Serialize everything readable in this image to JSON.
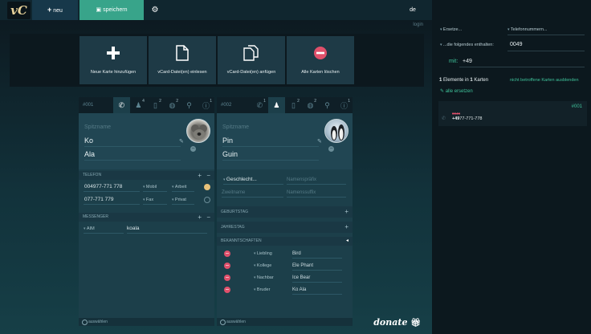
{
  "app": {
    "logo_text": "vC"
  },
  "toolbar": {
    "new_label": "neu",
    "save_label": "speichern",
    "lang": "de",
    "login": "login"
  },
  "actions": [
    {
      "label": "Neue Karte hinzufügen",
      "icon": "plus-icon"
    },
    {
      "label": "vCard-Datei(en) einlesen",
      "icon": "file-icon"
    },
    {
      "label": "vCard-Datei(en) anfügen",
      "icon": "files-icon"
    },
    {
      "label": "Alle Karten löschen",
      "icon": "delete-icon"
    }
  ],
  "card1": {
    "id": "#001",
    "tabs": [
      {
        "icon": "phone-icon",
        "badge": ""
      },
      {
        "icon": "people-icon",
        "badge": "4"
      },
      {
        "icon": "doc-icon",
        "badge": "2"
      },
      {
        "icon": "globe-icon",
        "badge": "2"
      },
      {
        "icon": "pin-icon",
        "badge": ""
      },
      {
        "icon": "info-icon",
        "badge": "1"
      }
    ],
    "nickname_placeholder": "Spitzname",
    "first_name": "Ko",
    "last_name": "Ala",
    "phone_section": "TELEFON",
    "phones": [
      {
        "number": "004977-771 778",
        "type": "Mobil",
        "category": "Arbeit",
        "preferred": true
      },
      {
        "number": "077-771 779",
        "type": "Fax",
        "category": "Privat",
        "preferred": false
      }
    ],
    "messenger_section": "MESSENGER",
    "messenger": {
      "service": "AIM",
      "handle": "koala"
    },
    "footer": "auswählen"
  },
  "card2": {
    "id": "#002",
    "tabs": [
      {
        "icon": "phone-icon",
        "badge": "1"
      },
      {
        "icon": "person-icon",
        "badge": ""
      },
      {
        "icon": "doc-icon",
        "badge": "2"
      },
      {
        "icon": "globe-icon",
        "badge": "2"
      },
      {
        "icon": "pin-icon",
        "badge": ""
      },
      {
        "icon": "info-icon",
        "badge": "1"
      }
    ],
    "nickname_placeholder": "Spitzname",
    "first_name": "Pin",
    "last_name": "Guin",
    "gender": "Geschlecht...",
    "name_prefix_placeholder": "Namenspräfix",
    "middle_name_placeholder": "Zweitname",
    "name_suffix_placeholder": "Namenssuffix",
    "birthday_section": "GEBURTSTAG",
    "anniversary_section": "JAHRESTAG",
    "relations_section": "BEKANNTSCHAFTEN",
    "relations": [
      {
        "type": "Liebling",
        "name": "Bird"
      },
      {
        "type": "Kollege",
        "name": "Ele Phant"
      },
      {
        "type": "Nachbar",
        "name": "Ice Bear"
      },
      {
        "type": "Bruder",
        "name": "Ko Ala"
      }
    ],
    "footer": "auswählen"
  },
  "replace": {
    "mode": "Ersetze...",
    "field": "Telefonnummern...",
    "condition": "...die folgendes enthalten:",
    "search_value": "0049",
    "with_label": "mit:",
    "replace_value": "+49",
    "count_text_1": "1",
    "count_text_2": " Elemente in ",
    "count_text_3": "1",
    "count_text_4": " Karten",
    "hide_link": "nicht betroffene Karten ausblenden",
    "replace_all": "alle ersetzen",
    "result_id": "#001",
    "result_old": "0049",
    "result_new_bold": "+49",
    "result_rest": "77-771-778"
  },
  "donate_label": "donate",
  "colors": {
    "accent": "#38a48a",
    "danger": "#e0506b",
    "highlight": "#3fc29a",
    "preferred": "#e8c27a"
  }
}
